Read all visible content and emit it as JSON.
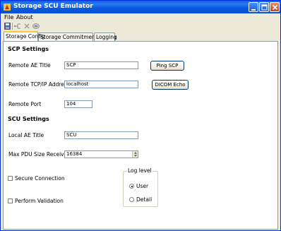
{
  "window": {
    "title": "Storage SCU Emulator"
  },
  "menu": {
    "file": "File",
    "about": "About"
  },
  "toolbar": {
    "icons": [
      "save-icon",
      "connect-icon",
      "delete-icon",
      "settings-icon"
    ]
  },
  "tabs": [
    {
      "label": "Storage Config",
      "active": true
    },
    {
      "label": "Storage Commitment Config",
      "active": false
    },
    {
      "label": "Logging",
      "active": false
    }
  ],
  "scp": {
    "title": "SCP Settings",
    "ae_title_label": "Remote AE Title",
    "ae_title_value": "SCP",
    "tcpip_label": "Remote TCP/IP Address",
    "tcpip_value": "localhost",
    "port_label": "Remote Port",
    "port_value": "104",
    "ping_button": "Ping SCP",
    "echo_button": "DICOM Echo"
  },
  "scu": {
    "title": "SCU Settings",
    "local_ae_label": "Local AE Title",
    "local_ae_value": "SCU",
    "pdu_label": "Max PDU Size Receive",
    "pdu_value": "16384"
  },
  "options": {
    "secure_label": "Secure Connection",
    "secure_checked": false,
    "validation_label": "Perform Validation",
    "validation_checked": false
  },
  "log_level": {
    "legend": "Log level",
    "user_label": "User",
    "detail_label": "Detail",
    "selected": "User"
  },
  "colors": {
    "titlebar": "#0a5ee4",
    "window_bg": "#ece9d8",
    "panel_bg": "#ffffff",
    "active_tab_accent": "#ffc83c",
    "field_border": "#7f9db9"
  }
}
